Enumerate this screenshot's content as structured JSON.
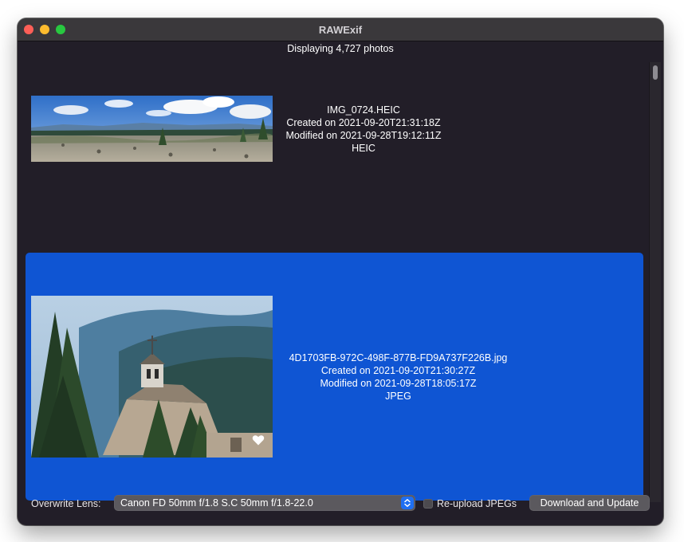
{
  "window": {
    "title": "RAWExif"
  },
  "header": {
    "count_label": "Displaying 4,727 photos"
  },
  "photos": [
    {
      "filename": "IMG_0724.HEIC",
      "created": "Created on 2021-09-20T21:31:18Z",
      "modified": "Modified on 2021-09-28T19:12:11Z",
      "format": "HEIC",
      "selected": false,
      "favorite": false,
      "thumbnail_icon": "mountain-panorama-thumbnail"
    },
    {
      "filename": "4D1703FB-972C-498F-877B-FD9A737F226B.jpg",
      "created": "Created on 2021-09-20T21:30:27Z",
      "modified": "Modified on 2021-09-28T18:05:17Z",
      "format": "JPEG",
      "selected": true,
      "favorite": true,
      "thumbnail_icon": "lodge-cupola-thumbnail"
    }
  ],
  "footer": {
    "lens_label": "Overwrite Lens:",
    "lens_value": "Canon FD 50mm f/1.8 S.C 50mm f/1.8-22.0",
    "reupload_label": "Re-upload JPEGs",
    "reupload_checked": false,
    "download_label": "Download and Update"
  },
  "colors": {
    "window_bg": "#221e28",
    "selection": "#0f55d3",
    "accent": "#1f6ff2"
  }
}
